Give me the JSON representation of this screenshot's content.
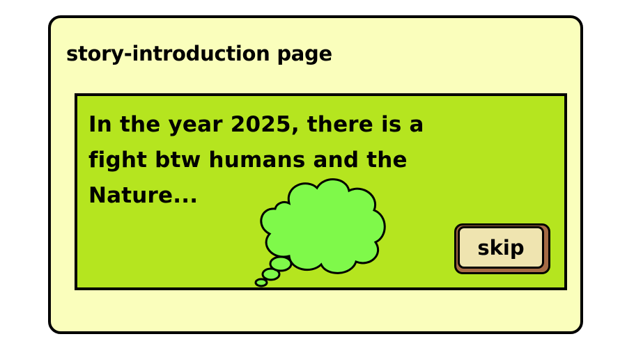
{
  "page": {
    "title": "story-introduction page"
  },
  "story": {
    "text": "In the year 2025, there is a fight btw humans and the Nature...",
    "icon": "thought-cloud-icon"
  },
  "buttons": {
    "skip_label": "skip"
  },
  "colors": {
    "frame_background": "#fafebc",
    "panel_background": "#b5e51f",
    "cloud_fill": "#7ff94a",
    "button_face": "#efe4b0",
    "button_shadow": "#a66b45",
    "outline": "#000000"
  }
}
